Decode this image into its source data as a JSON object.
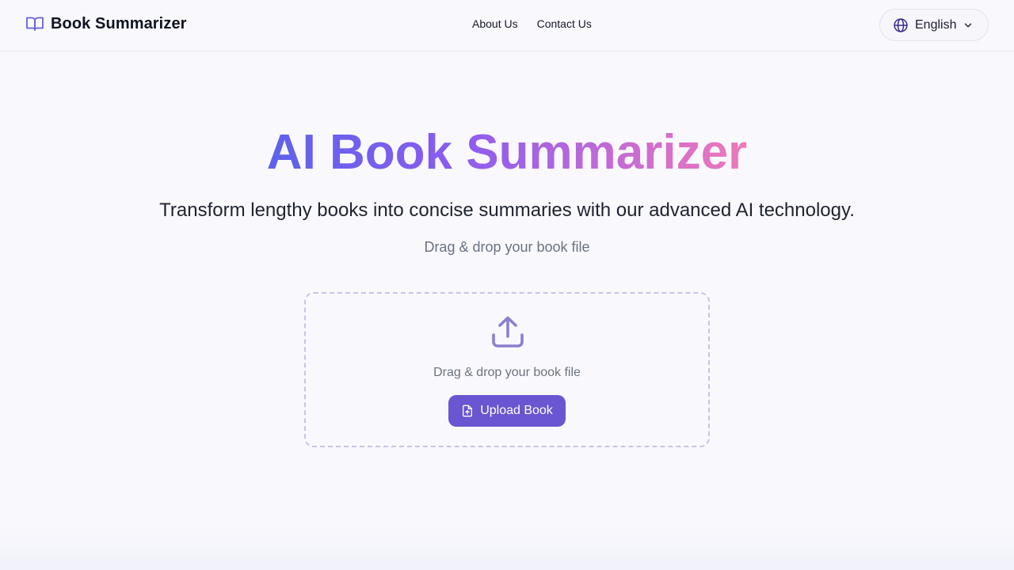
{
  "header": {
    "brand_name": "Book Summarizer",
    "brand_icon": "open-book-icon",
    "nav": [
      {
        "label": "About Us"
      },
      {
        "label": "Contact Us"
      }
    ],
    "language": {
      "selected": "English",
      "icon": "globe-icon"
    }
  },
  "hero": {
    "title": "AI Book Summarizer",
    "subtitle": "Transform lengthy books into concise summaries with our advanced AI technology.",
    "hint": "Drag & drop your book file"
  },
  "dropzone": {
    "icon": "upload-icon",
    "text": "Drag & drop your book file",
    "button_label": "Upload Book",
    "button_icon": "file-upload-icon"
  },
  "colors": {
    "accent": "#6a56d0",
    "gradient_start": "#5d62ea",
    "gradient_end": "#ef78ba",
    "background": "#f9f9fd"
  }
}
